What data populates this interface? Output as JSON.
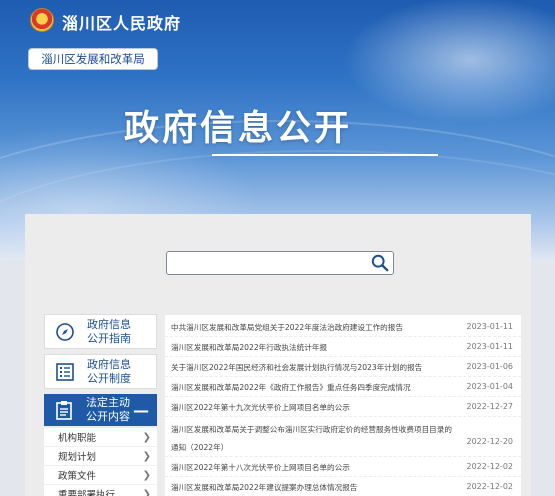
{
  "header": {
    "site_title": "淄川区人民政府",
    "dept_button": "淄川区发展和改革局",
    "page_heading": "政府信息公开"
  },
  "search": {
    "placeholder": ""
  },
  "sidebar": {
    "cards": [
      {
        "label_line1": "政府信息",
        "label_line2": "公开指南",
        "icon": "compass-icon"
      },
      {
        "label_line1": "政府信息",
        "label_line2": "公开制度",
        "icon": "document-list-icon"
      }
    ],
    "active": {
      "label_line1": "法定主动",
      "label_line2": "公开内容",
      "icon": "clipboard-icon",
      "toggle": "—"
    },
    "sub_items": [
      {
        "label": "机构职能"
      },
      {
        "label": "规划计划"
      },
      {
        "label": "政策文件"
      },
      {
        "label": "重要部署执行"
      }
    ]
  },
  "list": [
    {
      "title": "中共淄川区发展和改革局党组关于2022年度法治政府建设工作的报告",
      "date": "2023-01-11"
    },
    {
      "title": "淄川区发展和改革局2022年行政执法统计年报",
      "date": "2023-01-11"
    },
    {
      "title": "关于淄川区2022年国民经济和社会发展计划执行情况与2023年计划的报告",
      "date": "2023-01-06"
    },
    {
      "title": "淄川区发展和改革局2022年《政府工作报告》重点任务四季度完成情况",
      "date": "2023-01-04"
    },
    {
      "title": "淄川区2022年第十九次光伏平价上网项目名单的公示",
      "date": "2022-12-27"
    },
    {
      "title": "淄川区发展和改革局关于调整公布淄川区实行政府定价的经营服务性收费项目目录的通知（2022年）",
      "date": "2022-12-20"
    },
    {
      "title": "淄川区2022年第十八次光伏平价上网项目名单的公示",
      "date": "2022-12-02"
    },
    {
      "title": "淄川区发展和改革局2022年建议提案办理总体情况报告",
      "date": "2022-12-02"
    }
  ],
  "colors": {
    "primary": "#1e5aa6",
    "link": "#1f4f8f"
  }
}
